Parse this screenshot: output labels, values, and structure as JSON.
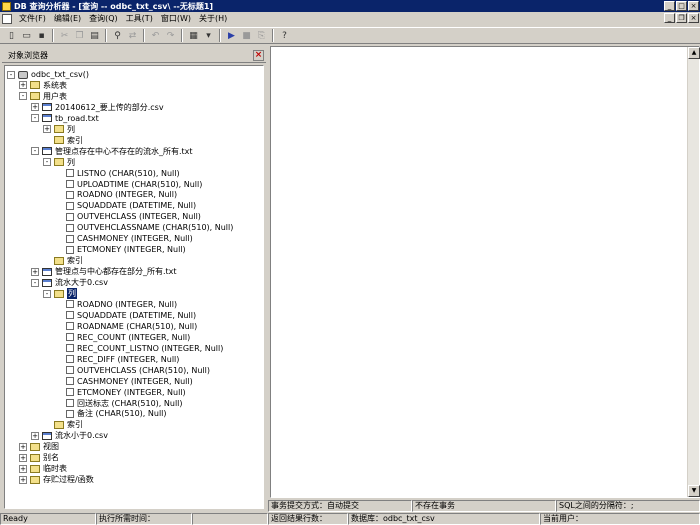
{
  "title": "DB 查询分析器 - [查询 -- odbc_txt_csv\\ --无标题1]",
  "menu": [
    "文件(F)",
    "编辑(E)",
    "查询(Q)",
    "工具(T)",
    "窗口(W)",
    "关于(H)"
  ],
  "explorer": {
    "title": "对象浏览器"
  },
  "tree": [
    {
      "label": "odbc_txt_csv()",
      "level": 0,
      "icon": "database-icon",
      "toggle": "-"
    },
    {
      "label": "系统表",
      "level": 1,
      "icon": "folder-icon",
      "toggle": "+"
    },
    {
      "label": "用户表",
      "level": 1,
      "icon": "folder-icon",
      "toggle": "-"
    },
    {
      "label": "20140612_要上传的部分.csv",
      "level": 2,
      "icon": "table-icon",
      "toggle": "+"
    },
    {
      "label": "tb_road.txt",
      "level": 2,
      "icon": "table-icon",
      "toggle": "-"
    },
    {
      "label": "列",
      "level": 3,
      "icon": "folder-icon",
      "toggle": "+"
    },
    {
      "label": "索引",
      "level": 3,
      "icon": "folder-icon",
      "toggle": ""
    },
    {
      "label": "管理点存在中心不存在的流水_所有.txt",
      "level": 2,
      "icon": "table-icon",
      "toggle": "-"
    },
    {
      "label": "列",
      "level": 3,
      "icon": "folder-icon",
      "toggle": "-"
    },
    {
      "label": "LISTNO (CHAR(510), Null)",
      "level": 4,
      "icon": "column-icon",
      "toggle": ""
    },
    {
      "label": "UPLOADTIME (CHAR(510), Null)",
      "level": 4,
      "icon": "column-icon",
      "toggle": ""
    },
    {
      "label": "ROADNO (INTEGER, Null)",
      "level": 4,
      "icon": "column-icon",
      "toggle": ""
    },
    {
      "label": "SQUADDATE (DATETIME, Null)",
      "level": 4,
      "icon": "column-icon",
      "toggle": ""
    },
    {
      "label": "OUTVEHCLASS (INTEGER, Null)",
      "level": 4,
      "icon": "column-icon",
      "toggle": ""
    },
    {
      "label": "OUTVEHCLASSNAME (CHAR(510), Null)",
      "level": 4,
      "icon": "column-icon",
      "toggle": ""
    },
    {
      "label": "CASHMONEY (INTEGER, Null)",
      "level": 4,
      "icon": "column-icon",
      "toggle": ""
    },
    {
      "label": "ETCMONEY (INTEGER, Null)",
      "level": 4,
      "icon": "column-icon",
      "toggle": ""
    },
    {
      "label": "索引",
      "level": 3,
      "icon": "folder-icon",
      "toggle": ""
    },
    {
      "label": "管理点与中心都存在部分_所有.txt",
      "level": 2,
      "icon": "table-icon",
      "toggle": "+"
    },
    {
      "label": "流水大于0.csv",
      "level": 2,
      "icon": "table-icon",
      "toggle": "-"
    },
    {
      "label": "列",
      "level": 3,
      "icon": "folder-icon",
      "toggle": "-",
      "selected": true
    },
    {
      "label": "ROADNO (INTEGER, Null)",
      "level": 4,
      "icon": "column-icon",
      "toggle": ""
    },
    {
      "label": "SQUADDATE (DATETIME, Null)",
      "level": 4,
      "icon": "column-icon",
      "toggle": ""
    },
    {
      "label": "ROADNAME (CHAR(510), Null)",
      "level": 4,
      "icon": "column-icon",
      "toggle": ""
    },
    {
      "label": "REC_COUNT (INTEGER, Null)",
      "level": 4,
      "icon": "column-icon",
      "toggle": ""
    },
    {
      "label": "REC_COUNT_LISTNO (INTEGER, Null)",
      "level": 4,
      "icon": "column-icon",
      "toggle": ""
    },
    {
      "label": "REC_DIFF (INTEGER, Null)",
      "level": 4,
      "icon": "column-icon",
      "toggle": ""
    },
    {
      "label": "OUTVEHCLASS (CHAR(510), Null)",
      "level": 4,
      "icon": "column-icon",
      "toggle": ""
    },
    {
      "label": "CASHMONEY (INTEGER, Null)",
      "level": 4,
      "icon": "column-icon",
      "toggle": ""
    },
    {
      "label": "ETCMONEY (INTEGER, Null)",
      "level": 4,
      "icon": "column-icon",
      "toggle": ""
    },
    {
      "label": "回送标志 (CHAR(510), Null)",
      "level": 4,
      "icon": "column-icon",
      "toggle": ""
    },
    {
      "label": "备注 (CHAR(510), Null)",
      "level": 4,
      "icon": "column-icon",
      "toggle": ""
    },
    {
      "label": "索引",
      "level": 3,
      "icon": "folder-icon",
      "toggle": ""
    },
    {
      "label": "流水小于0.csv",
      "level": 2,
      "icon": "table-icon",
      "toggle": "+"
    },
    {
      "label": "视图",
      "level": 1,
      "icon": "folder-icon",
      "toggle": "+"
    },
    {
      "label": "别名",
      "level": 1,
      "icon": "folder-icon",
      "toggle": "+"
    },
    {
      "label": "临时表",
      "level": 1,
      "icon": "folder-icon",
      "toggle": "+"
    },
    {
      "label": "存贮过程/函数",
      "level": 1,
      "icon": "folder-icon",
      "toggle": "+"
    }
  ],
  "status_top": [
    "事务提交方式：自动提交",
    "不存在事务",
    "SQL之间的分隔符：;"
  ],
  "status_bottom": [
    "Ready",
    "执行所需时间：",
    "返回结果行数：",
    "数据库：odbc_txt_csv",
    "当前用户："
  ]
}
